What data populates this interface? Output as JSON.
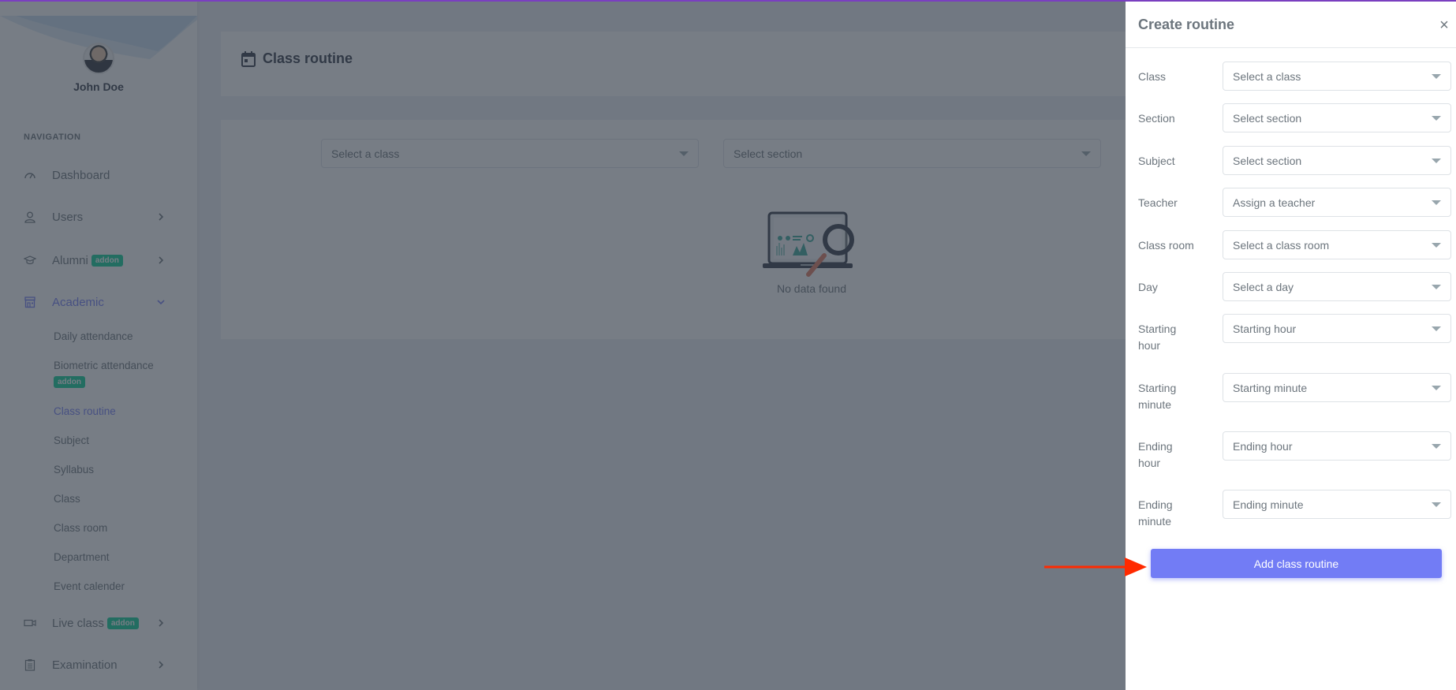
{
  "sidebar": {
    "user_name": "John Doe",
    "nav_heading": "Navigation",
    "items": [
      {
        "label": "Dashboard",
        "icon": "gauge-icon"
      },
      {
        "label": "Users",
        "icon": "user-icon",
        "has_children": true
      },
      {
        "label": "Alumni",
        "icon": "graduation-cap-icon",
        "badge": "addon",
        "has_children": true
      },
      {
        "label": "Academic",
        "icon": "school-building-icon",
        "expanded": true,
        "active": true
      },
      {
        "label": "Live class",
        "icon": "video-camera-icon",
        "badge": "addon",
        "has_children": true
      },
      {
        "label": "Examination",
        "icon": "clipboard-icon",
        "has_children": true
      }
    ],
    "academic_children": [
      {
        "label": "Daily attendance"
      },
      {
        "label": "Biometric attendance",
        "badge": "addon"
      },
      {
        "label": "Class routine",
        "active": true
      },
      {
        "label": "Subject"
      },
      {
        "label": "Syllabus"
      },
      {
        "label": "Class"
      },
      {
        "label": "Class room"
      },
      {
        "label": "Department"
      },
      {
        "label": "Event calender"
      }
    ]
  },
  "page": {
    "title": "Class routine",
    "title_icon": "calendar-icon",
    "filters": {
      "class_placeholder": "Select a class",
      "section_placeholder": "Select section"
    },
    "empty_state": "No data found"
  },
  "drawer": {
    "title": "Create routine",
    "close_icon": "×",
    "fields": [
      {
        "label": "Class",
        "value": "Select a class"
      },
      {
        "label": "Section",
        "value": "Select section"
      },
      {
        "label": "Subject",
        "value": "Select section"
      },
      {
        "label": "Teacher",
        "value": "Assign a teacher"
      },
      {
        "label": "Class room",
        "value": "Select a class room"
      },
      {
        "label": "Day",
        "value": "Select a day"
      },
      {
        "label": "Starting hour",
        "value": "Starting hour"
      },
      {
        "label": "Starting minute",
        "value": "Starting minute"
      },
      {
        "label": "Ending hour",
        "value": "Ending hour"
      },
      {
        "label": "Ending minute",
        "value": "Ending minute"
      }
    ],
    "submit_label": "Add class routine"
  },
  "colors": {
    "accent": "#727cf5",
    "badge": "#0acf97",
    "top_border": "#7a3fc0",
    "annotation_arrow": "#ff2a00"
  }
}
